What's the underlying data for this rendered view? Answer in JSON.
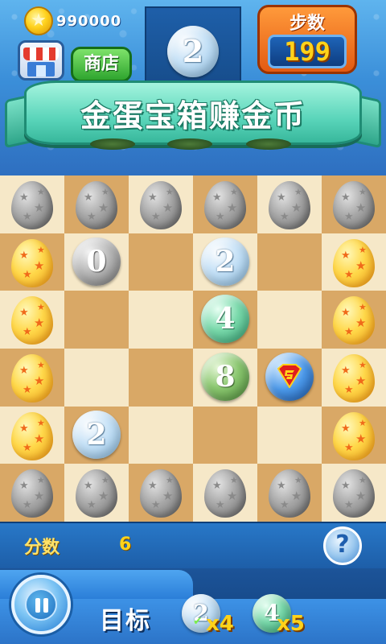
{
  "header": {
    "coins": "990000",
    "shop_label": "商店",
    "collect_number": "2",
    "steps_label": "步数",
    "steps_value": "199"
  },
  "banner": {
    "text": "金蛋宝箱赚金币"
  },
  "board": {
    "cols": 6,
    "rows": 6,
    "cells": [
      [
        "stone",
        "stone",
        "stone",
        "stone",
        "stone",
        "stone"
      ],
      [
        "gold",
        "bubble:0:grey",
        "",
        "bubble:2:blue",
        "",
        "gold"
      ],
      [
        "gold",
        "",
        "",
        "bubble:4:mint",
        "",
        "gold"
      ],
      [
        "gold",
        "",
        "",
        "bubble:8:green",
        "hero",
        "gold"
      ],
      [
        "gold",
        "bubble:2:blue",
        "",
        "",
        "",
        "gold"
      ],
      [
        "stone",
        "stone",
        "stone",
        "stone",
        "stone",
        "stone"
      ]
    ]
  },
  "score": {
    "label": "分数",
    "value": "6"
  },
  "bottom": {
    "target_label": "目标",
    "goals": [
      {
        "number": "2",
        "style": "blue",
        "count": "x4"
      },
      {
        "number": "4",
        "style": "mint",
        "count": "x5"
      }
    ]
  },
  "icons": {
    "coin": "coin-star-icon",
    "shop": "storefront-icon",
    "help": "question-mark-icon",
    "pause": "pause-icon",
    "hero": "superman-shield-icon"
  },
  "colors": {
    "sky_top": "#5fb4ee",
    "banner": "#5ad5ba",
    "board_light": "#f6e8c8",
    "board_dark": "#d9a866",
    "score_text": "#ffd21a",
    "steps_box": "#e35a12"
  }
}
